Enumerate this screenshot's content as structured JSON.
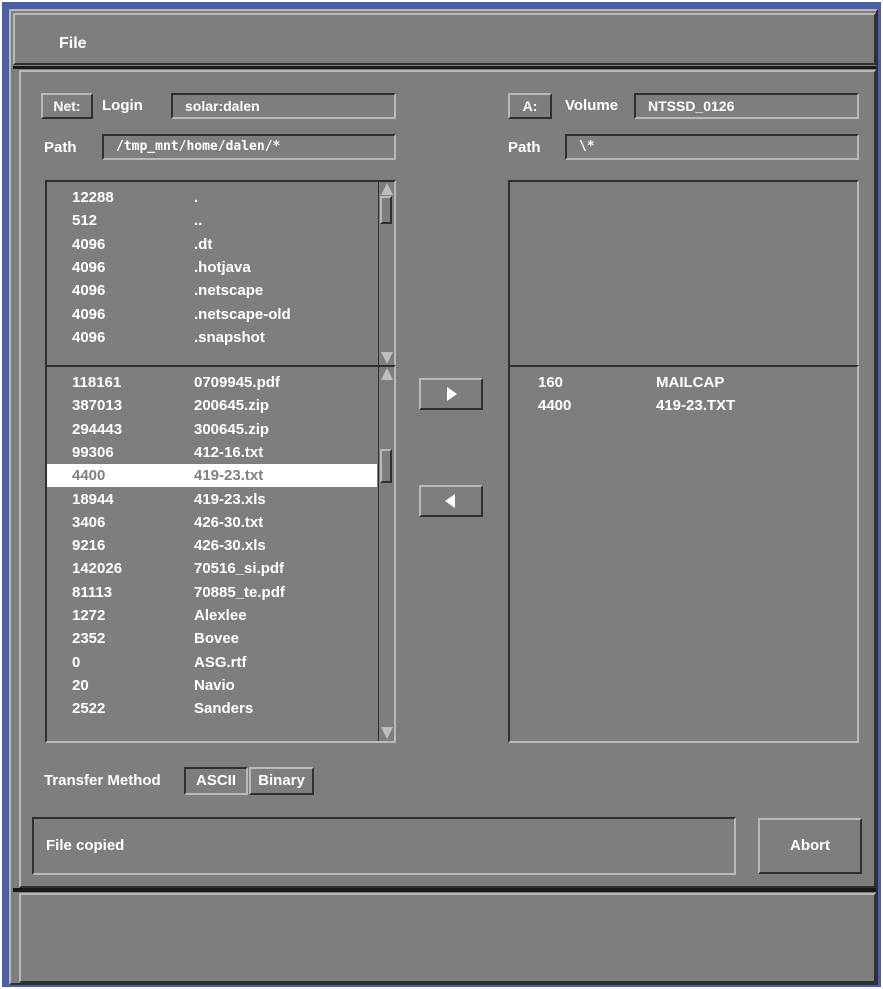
{
  "menu": {
    "file": "File"
  },
  "left": {
    "net_button": "Net:",
    "login_label": "Login",
    "login_value": "solar:dalen",
    "path_label": "Path",
    "path_value": "/tmp_mnt/home/dalen/*",
    "dirs": [
      {
        "size": "12288",
        "name": "."
      },
      {
        "size": "512",
        "name": ".."
      },
      {
        "size": "4096",
        "name": ".dt"
      },
      {
        "size": "4096",
        "name": ".hotjava"
      },
      {
        "size": "4096",
        "name": ".netscape"
      },
      {
        "size": "4096",
        "name": ".netscape-old"
      },
      {
        "size": "4096",
        "name": ".snapshot"
      }
    ],
    "files": [
      {
        "size": "118161",
        "name": "0709945.pdf"
      },
      {
        "size": "387013",
        "name": "200645.zip"
      },
      {
        "size": "294443",
        "name": "300645.zip"
      },
      {
        "size": "99306",
        "name": "412-16.txt"
      },
      {
        "size": "4400",
        "name": "419-23.txt",
        "selected": true
      },
      {
        "size": "18944",
        "name": "419-23.xls"
      },
      {
        "size": "3406",
        "name": "426-30.txt"
      },
      {
        "size": "9216",
        "name": "426-30.xls"
      },
      {
        "size": "142026",
        "name": "70516_si.pdf"
      },
      {
        "size": "81113",
        "name": "70885_te.pdf"
      },
      {
        "size": "1272",
        "name": "Alexlee"
      },
      {
        "size": "2352",
        "name": "Bovee"
      },
      {
        "size": "0",
        "name": "ASG.rtf"
      },
      {
        "size": "20",
        "name": "Navio"
      },
      {
        "size": "2522",
        "name": "Sanders"
      }
    ]
  },
  "right": {
    "drive_button": "A:",
    "volume_label": "Volume",
    "volume_value": "NTSSD_0126",
    "path_label": "Path",
    "path_value": "\\*",
    "files": [
      {
        "size": "160",
        "name": "MAILCAP"
      },
      {
        "size": "4400",
        "name": "419-23.TXT"
      }
    ]
  },
  "transfer": {
    "label": "Transfer Method",
    "ascii": "ASCII",
    "binary": "Binary",
    "copy_right_icon": "triangle-right-icon",
    "copy_left_icon": "triangle-left-icon"
  },
  "status": {
    "message": "File copied",
    "abort": "Abort"
  },
  "colors": {
    "panel": "#7e7e7e",
    "window_border": "#4a5fa8",
    "selection": "#ffffff"
  }
}
